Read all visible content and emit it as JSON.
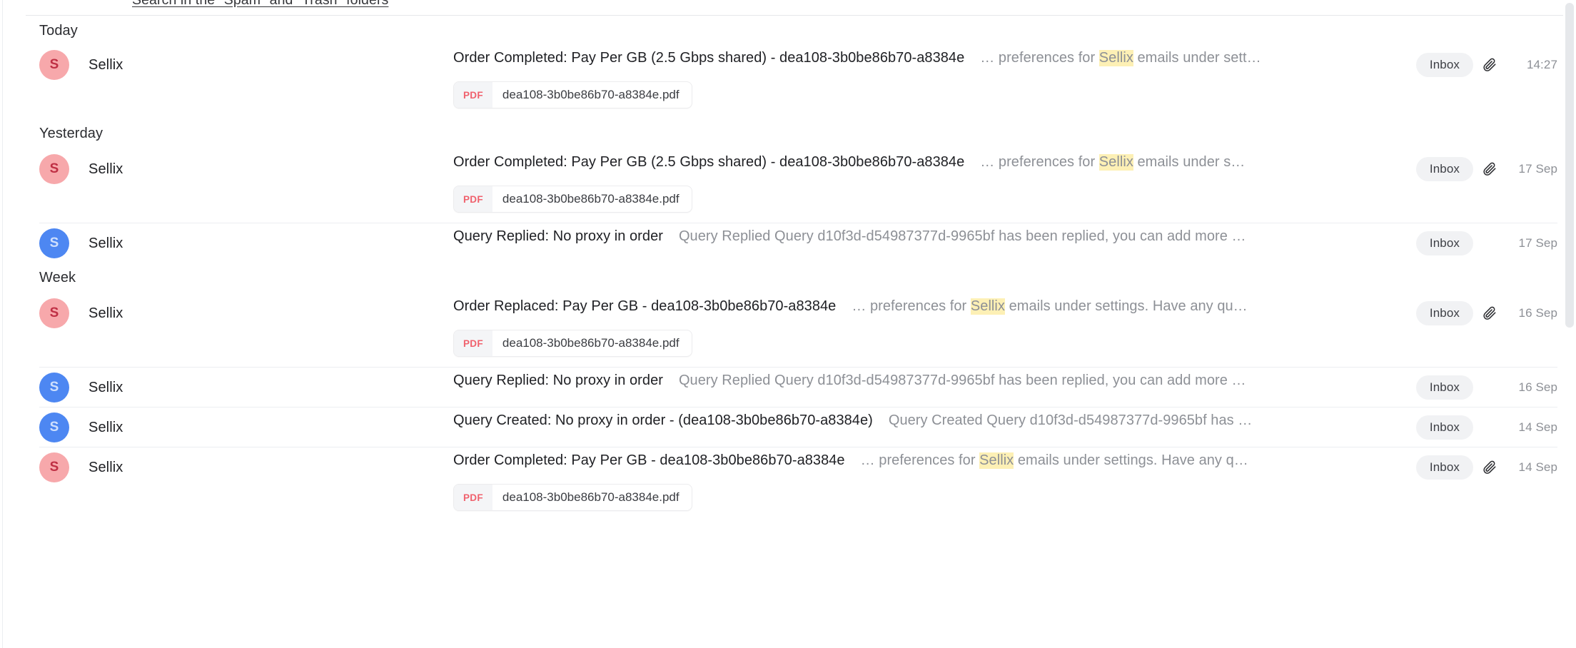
{
  "search_hint": {
    "link_label": "Search in the \"Spam\" and \"Trash\" folders"
  },
  "colors": {
    "avatar_pink_bg": "#f7a8ab",
    "avatar_pink_fg": "#bf2f44",
    "avatar_blue_bg": "#4d87f2",
    "avatar_blue_fg": "#cfe0fd",
    "highlight": "#fdf0b5",
    "badge_bg": "#f1f2f4",
    "pdf_label": "#f0616d"
  },
  "icons": {
    "attachment": "paperclip-icon",
    "pdf": "pdf-file-icon"
  },
  "sections": [
    {
      "label": "Today",
      "rows": [
        {
          "avatar_letter": "S",
          "avatar_color": "pink",
          "sender": "Sellix",
          "subject": "Order Completed: Pay Per GB (2.5 Gbps shared) - dea108-3b0be86b70-a8384e",
          "preview_before": "… preferences for ",
          "preview_highlight": "Sellix",
          "preview_after": " emails under sett…",
          "folder": "Inbox",
          "has_attachment": true,
          "date": "14:27",
          "attachment": {
            "type": "PDF",
            "name": "dea108-3b0be86b70-a8384e.pdf"
          }
        }
      ]
    },
    {
      "label": "Yesterday",
      "rows": [
        {
          "avatar_letter": "S",
          "avatar_color": "pink",
          "sender": "Sellix",
          "subject": "Order Completed: Pay Per GB (2.5 Gbps shared) - dea108-3b0be86b70-a8384e",
          "preview_before": "… preferences for ",
          "preview_highlight": "Sellix",
          "preview_after": " emails under s…",
          "folder": "Inbox",
          "has_attachment": true,
          "date": "17 Sep",
          "attachment": {
            "type": "PDF",
            "name": "dea108-3b0be86b70-a8384e.pdf"
          }
        },
        {
          "avatar_letter": "S",
          "avatar_color": "blue",
          "sender": "Sellix",
          "subject": "Query Replied: No proxy in order",
          "preview_before": "Query Replied Query d10f3d-d54987377d-9965bf has been replied, you can add more …",
          "preview_highlight": "",
          "preview_after": "",
          "folder": "Inbox",
          "has_attachment": false,
          "date": "17 Sep",
          "attachment": null
        }
      ]
    },
    {
      "label": "Week",
      "rows": [
        {
          "avatar_letter": "S",
          "avatar_color": "pink",
          "sender": "Sellix",
          "subject": "Order Replaced: Pay Per GB - dea108-3b0be86b70-a8384e",
          "preview_before": "… preferences for ",
          "preview_highlight": "Sellix",
          "preview_after": " emails under settings. Have any qu…",
          "folder": "Inbox",
          "has_attachment": true,
          "date": "16 Sep",
          "attachment": {
            "type": "PDF",
            "name": "dea108-3b0be86b70-a8384e.pdf"
          }
        },
        {
          "avatar_letter": "S",
          "avatar_color": "blue",
          "sender": "Sellix",
          "subject": "Query Replied: No proxy in order",
          "preview_before": "Query Replied Query d10f3d-d54987377d-9965bf has been replied, you can add more …",
          "preview_highlight": "",
          "preview_after": "",
          "folder": "Inbox",
          "has_attachment": false,
          "date": "16 Sep",
          "attachment": null
        },
        {
          "avatar_letter": "S",
          "avatar_color": "blue",
          "sender": "Sellix",
          "subject": "Query Created: No proxy in order - (dea108-3b0be86b70-a8384e)",
          "preview_before": "Query Created Query d10f3d-d54987377d-9965bf has …",
          "preview_highlight": "",
          "preview_after": "",
          "folder": "Inbox",
          "has_attachment": false,
          "date": "14 Sep",
          "attachment": null
        },
        {
          "avatar_letter": "S",
          "avatar_color": "pink",
          "sender": "Sellix",
          "subject": "Order Completed: Pay Per GB - dea108-3b0be86b70-a8384e",
          "preview_before": "… preferences for ",
          "preview_highlight": "Sellix",
          "preview_after": " emails under settings. Have any q…",
          "folder": "Inbox",
          "has_attachment": true,
          "date": "14 Sep",
          "attachment": {
            "type": "PDF",
            "name": "dea108-3b0be86b70-a8384e.pdf"
          }
        }
      ]
    }
  ]
}
